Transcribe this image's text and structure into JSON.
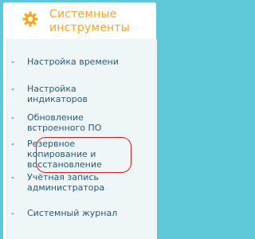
{
  "colors": {
    "background": "#5fc8d8",
    "panel": "#ffffff",
    "accent": "#f5a623",
    "link": "#2a5a7a",
    "highlight": "#d9202a"
  },
  "menu": {
    "icon": "gear-icon",
    "title_line1": "Системные",
    "title_line2": "инструменты",
    "items": [
      {
        "line1": "Настройка времени",
        "line2": ""
      },
      {
        "line1": "Настройка",
        "line2": "индикаторов"
      },
      {
        "line1": "Обновление",
        "line2": "встроенного ПО"
      },
      {
        "line1": "Резервное",
        "line2": "копирование и",
        "line3": "восстановление"
      },
      {
        "line1": "Учётная запись",
        "line2": "администратора"
      },
      {
        "line1": "Системный журнал",
        "line2": ""
      }
    ],
    "dash": "-"
  }
}
